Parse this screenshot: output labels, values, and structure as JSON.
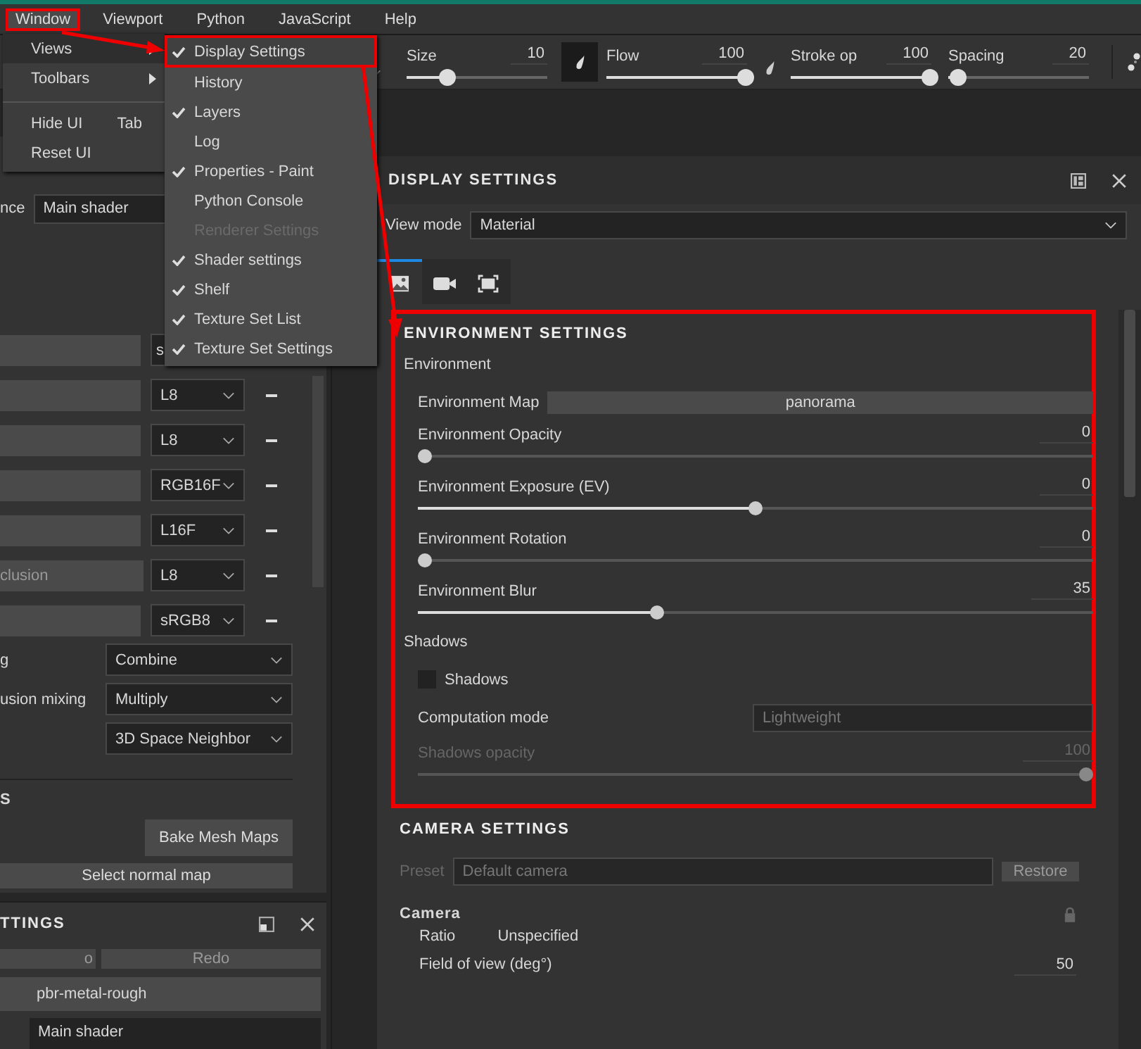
{
  "menubar": [
    {
      "label": "Window",
      "selected": true
    },
    {
      "label": "Viewport",
      "selected": false
    },
    {
      "label": "Python",
      "selected": false
    },
    {
      "label": "JavaScript",
      "selected": false
    },
    {
      "label": "Help",
      "selected": false
    }
  ],
  "window_menu": [
    {
      "label": "Views",
      "kind": "submenu",
      "selected": true
    },
    {
      "label": "Toolbars",
      "kind": "submenu",
      "selected": false
    },
    {
      "label": "Hide UI",
      "kind": "command",
      "shortcut": "Tab",
      "selected": false
    },
    {
      "label": "Reset UI",
      "kind": "command",
      "selected": false
    }
  ],
  "views_submenu": [
    {
      "label": "Display Settings",
      "checked": true,
      "disabled": false,
      "selected": true
    },
    {
      "label": "History",
      "checked": false,
      "disabled": false,
      "selected": false
    },
    {
      "label": "Layers",
      "checked": true,
      "disabled": false,
      "selected": false
    },
    {
      "label": "Log",
      "checked": false,
      "disabled": false,
      "selected": false
    },
    {
      "label": "Properties - Paint",
      "checked": true,
      "disabled": false,
      "selected": false
    },
    {
      "label": "Python Console",
      "checked": false,
      "disabled": false,
      "selected": false
    },
    {
      "label": "Renderer Settings",
      "checked": false,
      "disabled": true,
      "selected": false
    },
    {
      "label": "Shader settings",
      "checked": true,
      "disabled": false,
      "selected": false
    },
    {
      "label": "Shelf",
      "checked": true,
      "disabled": false,
      "selected": false
    },
    {
      "label": "Texture Set List",
      "checked": true,
      "disabled": false,
      "selected": false
    },
    {
      "label": "Texture Set Settings",
      "checked": true,
      "disabled": false,
      "selected": false
    }
  ],
  "toolbar_sliders": [
    {
      "label": "Size",
      "value": "10",
      "level": 0.3
    },
    {
      "label": "Flow",
      "value": "100",
      "level": 1
    },
    {
      "label": "Stroke op",
      "value": "100",
      "level": 1
    },
    {
      "label": "Spacing",
      "value": "20",
      "level": 0.08
    }
  ],
  "left_panel": {
    "instance_label": "nce",
    "instance_value": "Main shader",
    "channels": [
      {
        "format": "s",
        "kind": "partial"
      },
      {
        "format": "L8",
        "kind": "full"
      },
      {
        "format": "L8",
        "kind": "full"
      },
      {
        "format": "RGB16F",
        "kind": "full"
      },
      {
        "format": "L16F",
        "kind": "full"
      },
      {
        "name": "clusion",
        "format": "L8",
        "kind": "full"
      },
      {
        "format": "sRGB8",
        "kind": "full"
      }
    ],
    "mixing": [
      {
        "label": "g",
        "value": "Combine"
      },
      {
        "label": "usion mixing",
        "value": "Multiply"
      },
      {
        "value": "3D Space Neighbor"
      }
    ],
    "section_title": "S",
    "bake_button": "Bake Mesh Maps",
    "normal_button": "Select normal map"
  },
  "texture_set_panel": {
    "title": "TTINGS",
    "undo": "o",
    "redo": "Redo",
    "shader_preset": "pbr-metal-rough",
    "shader": "Main shader"
  },
  "display_settings": {
    "title": "DISPLAY SETTINGS",
    "view_mode_label": "View mode",
    "view_mode": "Material",
    "tabs": [
      {
        "kind": "image",
        "selected": true
      },
      {
        "kind": "camera",
        "selected": false
      },
      {
        "kind": "frame",
        "selected": false
      }
    ],
    "environment": {
      "title": "ENVIRONMENT SETTINGS",
      "group": "Environment",
      "map_label": "Environment Map",
      "map_value": "panorama",
      "sliders": [
        {
          "label": "Environment Opacity",
          "value": "0",
          "level": 0,
          "disabled": false
        },
        {
          "label": "Environment Exposure (EV)",
          "value": "0",
          "level": 0.5,
          "disabled": false
        },
        {
          "label": "Environment Rotation",
          "value": "0",
          "level": 0,
          "disabled": false
        },
        {
          "label": "Environment Blur",
          "value": "35",
          "level": 0.35,
          "disabled": false
        }
      ],
      "shadows_group": "Shadows",
      "shadows_checkbox": {
        "label": "Shadows",
        "checked": false
      },
      "computation_label": "Computation mode",
      "computation_value": "Lightweight",
      "shadow_sliders": [
        {
          "label": "Shadows opacity",
          "value": "100",
          "level": 1,
          "disabled": true
        }
      ]
    },
    "camera": {
      "title": "CAMERA SETTINGS",
      "preset_label": "Preset",
      "preset_value": "Default camera",
      "restore": "Restore",
      "group": "Camera",
      "rows": [
        {
          "label": "Ratio",
          "value": "Unspecified",
          "kind": "text"
        },
        {
          "label": "Field of view (deg°)",
          "value": "50",
          "kind": "number"
        }
      ]
    }
  }
}
